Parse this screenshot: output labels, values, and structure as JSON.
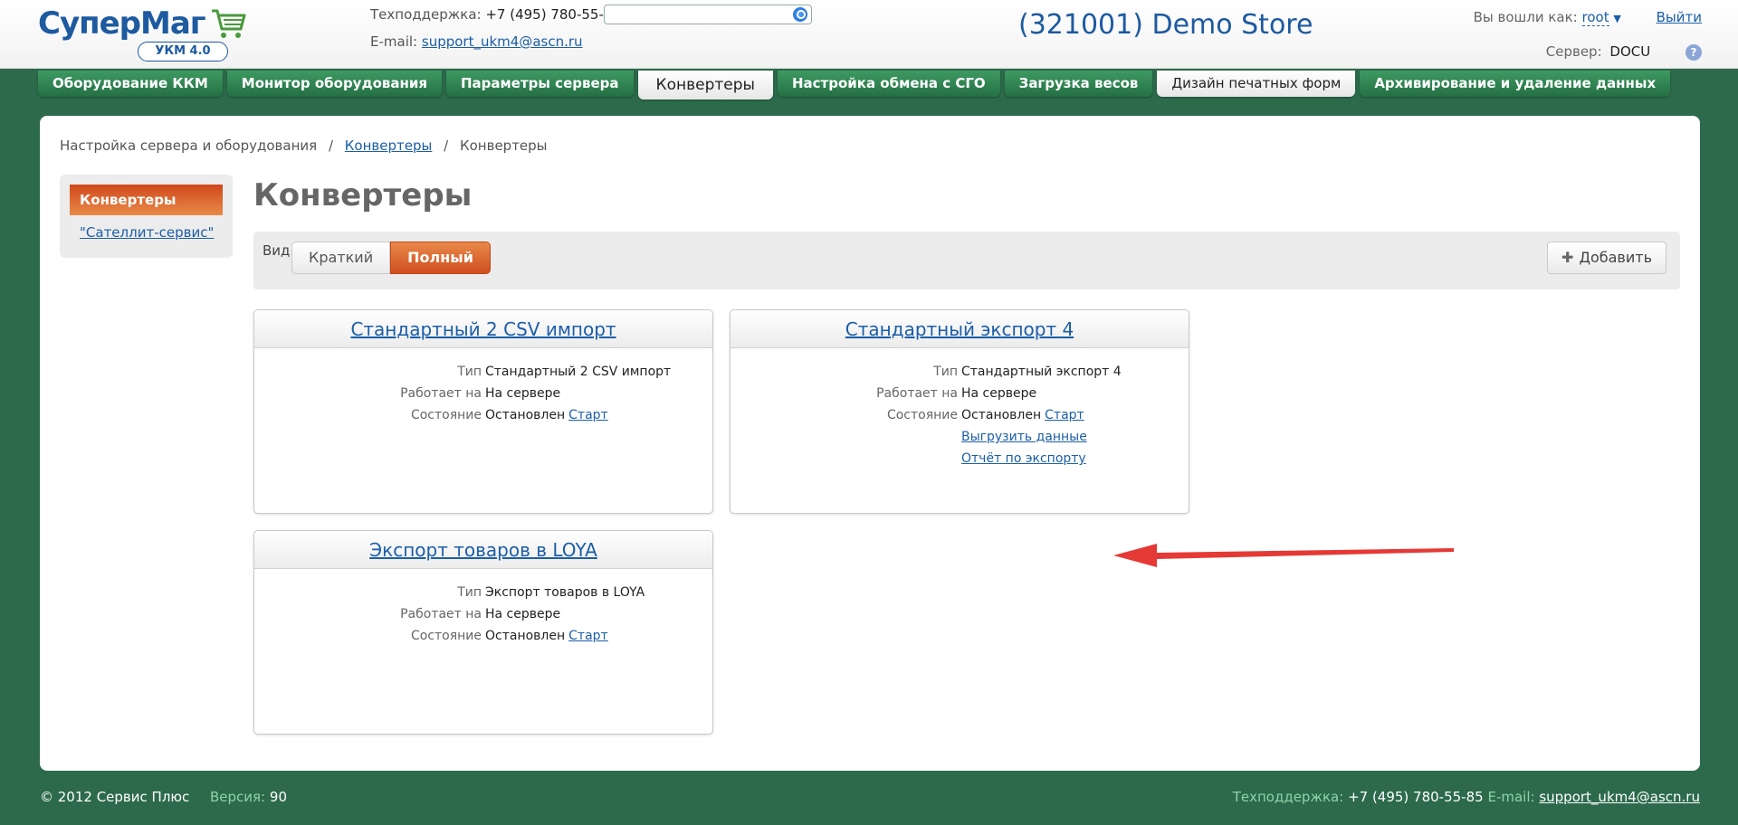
{
  "header": {
    "logo_text": "СуперМаг",
    "logo_badge": "УКМ 4.0",
    "support_label": "Техподдержка:",
    "support_phone": "+7 (495) 780-55-85",
    "email_label": "E-mail:",
    "email": "support_ukm4@ascn.ru",
    "search_value": "",
    "store_title": "(321001) Demo Store",
    "logged_in_label": "Вы вошли как:",
    "user": "root",
    "logout": "Выйти",
    "server_label": "Сервер:",
    "server_value": "DOCU",
    "help_icon": "?"
  },
  "tabs": [
    {
      "label": "Оборудование ККМ"
    },
    {
      "label": "Монитор оборудования"
    },
    {
      "label": "Параметры сервера"
    },
    {
      "label": "Конвертеры"
    },
    {
      "label": "Настройка обмена с СГО"
    },
    {
      "label": "Загрузка весов"
    },
    {
      "label": "Дизайн печатных форм"
    },
    {
      "label": "Архивирование и удаление данных"
    }
  ],
  "breadcrumb": {
    "root": "Настройка сервера и оборудования",
    "sep": "/",
    "link": "Конвертеры",
    "current": "Конвертеры"
  },
  "sidebar": {
    "active": "Конвертеры",
    "link": "\"Сателлит-сервис\""
  },
  "page_title": "Конвертеры",
  "view": {
    "label": "Вид:",
    "brief": "Краткий",
    "full": "Полный",
    "add": "Добавить"
  },
  "labels": {
    "type": "Тип",
    "runs_on": "Работает на",
    "state": "Состояние"
  },
  "cards": [
    {
      "title": "Стандартный 2 CSV импорт",
      "type": "Стандартный 2 CSV импорт",
      "runs_on": "На сервере",
      "state": "Остановлен",
      "start": "Старт"
    },
    {
      "title": "Стандартный экспорт 4",
      "type": "Стандартный экспорт 4",
      "runs_on": "На сервере",
      "state": "Остановлен",
      "start": "Старт",
      "extra_links": [
        "Выгрузить данные",
        "Отчёт по экспорту"
      ]
    },
    {
      "title": "Экспорт товаров в LOYA",
      "type": "Экспорт товаров в LOYA",
      "runs_on": "На сервере",
      "state": "Остановлен",
      "start": "Старт"
    }
  ],
  "footer": {
    "copyright": "© 2012 Сервис Плюс",
    "version_label": "Версия:",
    "version": "90",
    "support_label": "Техподдержка:",
    "support_phone": "+7 (495) 780-55-85",
    "email_label": "E-mail:",
    "email": "support_ukm4@ascn.ru"
  },
  "colors": {
    "background": "#2c6a4b",
    "tab_green": "#2f8553",
    "accent_orange": "#d8581f",
    "link_blue": "#1b5ea8",
    "title_blue": "#1d5aa0",
    "arrow_red": "#e53935"
  }
}
